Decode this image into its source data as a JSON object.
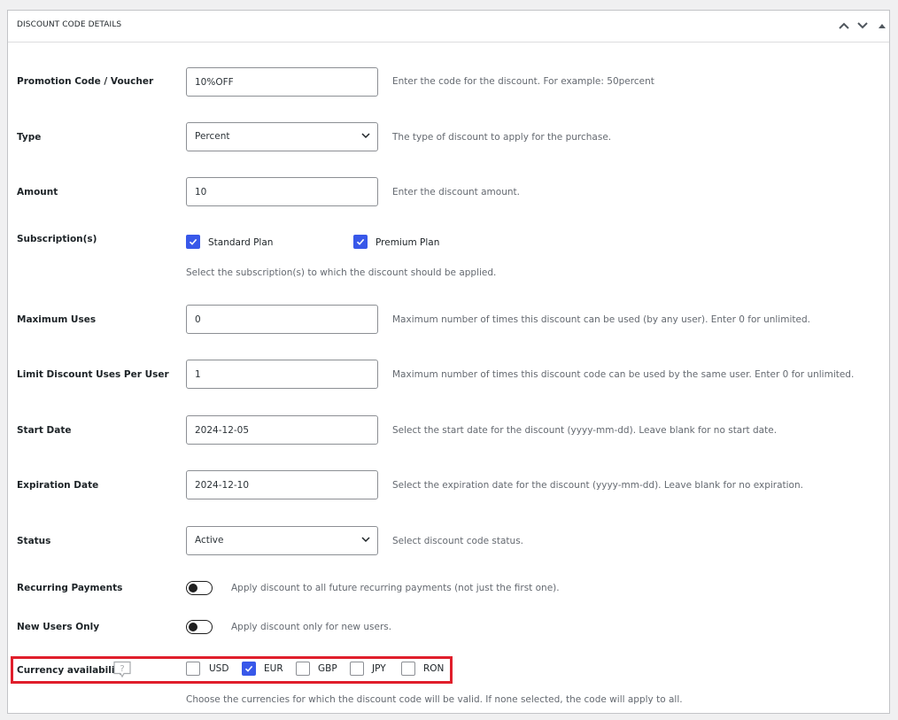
{
  "panel": {
    "title": "DISCOUNT CODE DETAILS",
    "icons": [
      "chevron-up-icon",
      "chevron-down-icon",
      "caret-up-icon"
    ]
  },
  "fields": {
    "promo": {
      "label": "Promotion Code / Voucher",
      "value": "10%OFF",
      "description": "Enter the code for the discount. For example: 50percent"
    },
    "type": {
      "label": "Type",
      "value": "Percent",
      "description": "The type of discount to apply for the purchase."
    },
    "amount": {
      "label": "Amount",
      "value": "10",
      "description": "Enter the discount amount."
    },
    "subscriptions": {
      "label": "Subscription(s)",
      "options": [
        {
          "label": "Standard Plan",
          "checked": true
        },
        {
          "label": "Premium Plan",
          "checked": true
        }
      ],
      "description": "Select the subscription(s) to which the discount should be applied."
    },
    "max_uses": {
      "label": "Maximum Uses",
      "value": "0",
      "description": "Maximum number of times this discount can be used (by any user). Enter 0 for unlimited."
    },
    "limit_per_user": {
      "label": "Limit Discount Uses Per User",
      "value": "1",
      "description": "Maximum number of times this discount code can be used by the same user. Enter 0 for unlimited."
    },
    "start_date": {
      "label": "Start Date",
      "value": "2024-12-05",
      "description": "Select the start date for the discount (yyyy-mm-dd). Leave blank for no start date."
    },
    "expiration_date": {
      "label": "Expiration Date",
      "value": "2024-12-10",
      "description": "Select the expiration date for the discount (yyyy-mm-dd). Leave blank for no expiration."
    },
    "status": {
      "label": "Status",
      "value": "Active",
      "description": "Select discount code status."
    },
    "recurring": {
      "label": "Recurring Payments",
      "enabled": false,
      "description": "Apply discount to all future recurring payments (not just the first one)."
    },
    "new_users": {
      "label": "New Users Only",
      "enabled": false,
      "description": "Apply discount only for new users."
    },
    "currency": {
      "label": "Currency availability",
      "options": [
        {
          "label": "USD",
          "checked": false
        },
        {
          "label": "EUR",
          "checked": true
        },
        {
          "label": "GBP",
          "checked": false
        },
        {
          "label": "JPY",
          "checked": false
        },
        {
          "label": "RON",
          "checked": false
        }
      ],
      "description": "Choose the currencies for which the discount code will be valid. If none selected, the code will apply to all."
    }
  },
  "colors": {
    "accent": "#3858e9",
    "highlight": "#e01e2b"
  }
}
